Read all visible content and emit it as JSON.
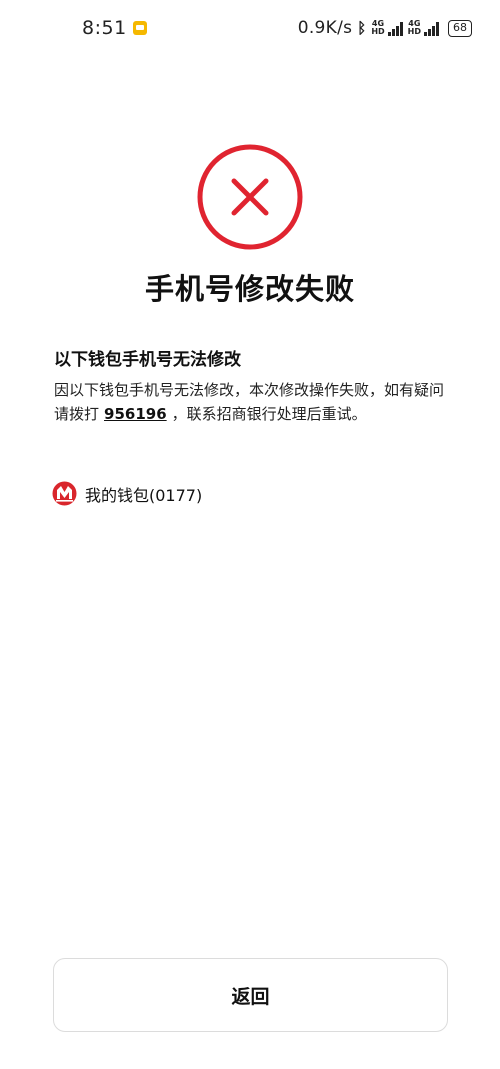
{
  "status_bar": {
    "time": "8:51",
    "net_speed": "0.9K/s",
    "sim1_label": "4G",
    "sim1_hd": "HD",
    "sim2_label": "4G",
    "sim2_hd": "HD",
    "battery": "68"
  },
  "result": {
    "icon": "error-x-circle-icon",
    "icon_color": "#e02430",
    "title": "手机号修改失败"
  },
  "notice": {
    "heading": "以下钱包手机号无法修改",
    "desc_prefix": "因以下钱包手机号无法修改，本次修改操作失败，如有疑问请拨打",
    "phone": "956196",
    "desc_suffix": "，联系招商银行处理后重试。"
  },
  "wallet": {
    "icon": "cmb-bank-logo-icon",
    "label": "我的钱包(0177)",
    "logo_color": "#d9262c"
  },
  "actions": {
    "back_label": "返回"
  }
}
